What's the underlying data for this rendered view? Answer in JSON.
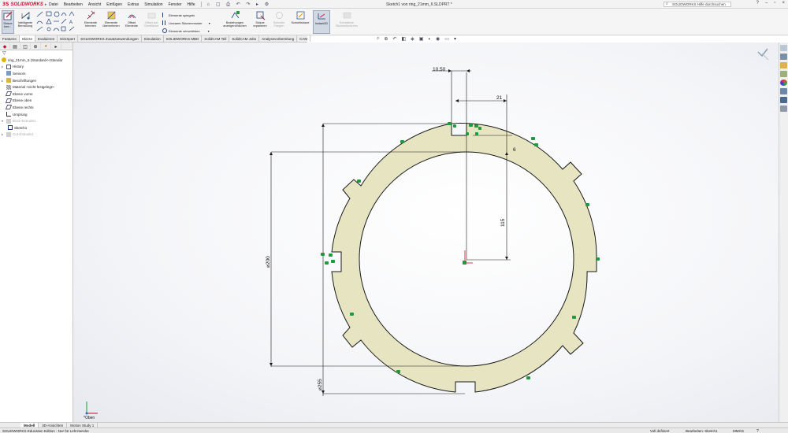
{
  "app": {
    "brand": "SOLIDWORKS",
    "ds_mark": "3S",
    "document_title": "Sketch1 von ring_21mm_6.SLDPRT *",
    "search_placeholder": "SOLIDWORKS Hilfe durchsuchen"
  },
  "menu": [
    "Datei",
    "Bearbeiten",
    "Ansicht",
    "Einfügen",
    "Extras",
    "Simulation",
    "Fenster",
    "Hilfe"
  ],
  "ribbon": {
    "exit_sketch": "Skizze bee...",
    "smart_dimension": "Intelligente Bemaßung",
    "trim_entities": "Elemente trimmen",
    "convert_entities": "Elemente übernehmen",
    "offset_entities": "Offset Elemente",
    "offset_on_surface": "Offset auf Oberfläche",
    "mirror_entities": "Elemente spiegeln",
    "linear_pattern": "Lineares Skizzenmuster",
    "move_entities": "Elemente verschieben",
    "display_relations": "Beziehungen anzeigen/löschen",
    "repair_sketch": "Skizze reparieren",
    "quick_snaps": "Schnelle Fangen",
    "rapid_sketch": "Schnellskizze",
    "instant2d": "Instant2D",
    "shaded_sketch": "Schattierte Skizzenkonturen"
  },
  "tabs": [
    "Features",
    "Skizze",
    "Evaluieren",
    "DimXpert",
    "SOLIDWORKS Zusatzanwendungen",
    "Simulation",
    "SOLIDWORKS MBD",
    "SolidCAM Teil",
    "SolidCAM Jobs",
    "Analysevorbereitung",
    "CAM"
  ],
  "active_tab": "Skizze",
  "tree": {
    "root": "ring_21mm_6 (Standard<<Standar",
    "items": [
      "History",
      "Sensors",
      "Beschriftungen",
      "Material <nicht festgelegt>",
      "Ebene vorne",
      "Ebene oben",
      "Ebene rechts",
      "Ursprung",
      "Boss-Extrude1",
      "Sketch1",
      "Cut-Extrude1"
    ]
  },
  "dimensions": {
    "slot_width": "10.50",
    "slot_offset": "21",
    "slot_depth": "6",
    "inner_radius_label": "115",
    "inner_diameter": "⌀200",
    "outer_diameter": "⌀255"
  },
  "triad_label": "*Oben",
  "bottom_tabs": [
    "Modell",
    "3D-Ansichten",
    "Motion Study 1"
  ],
  "status": {
    "left": "SOLIDWORKS Education Edition - Nur für Lehrzwecke",
    "state": "Voll definiert",
    "editing": "Bearbeiten: Sketch1",
    "units": "MMGS"
  },
  "colors": {
    "ring_fill": "#e6e4c1",
    "sketch_line": "#1a1a1a",
    "relation_icon": "#1f9a3d",
    "brand_red": "#c8102e"
  }
}
